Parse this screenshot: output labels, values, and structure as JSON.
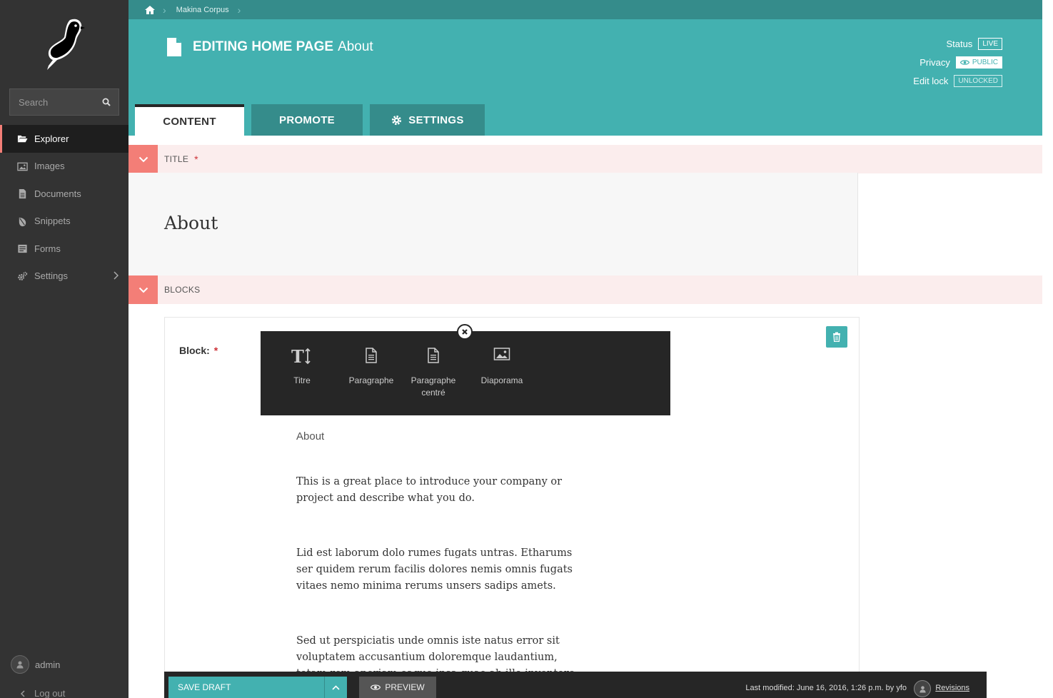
{
  "sidebar": {
    "search_placeholder": "Search",
    "items": [
      {
        "label": "Explorer",
        "icon": "folder-open-icon",
        "active": true
      },
      {
        "label": "Images",
        "icon": "image-icon"
      },
      {
        "label": "Documents",
        "icon": "document-icon"
      },
      {
        "label": "Snippets",
        "icon": "snippet-icon"
      },
      {
        "label": "Forms",
        "icon": "form-icon"
      },
      {
        "label": "Settings",
        "icon": "cogs-icon",
        "has_submenu": true
      }
    ],
    "user": "admin",
    "logout": "Log out"
  },
  "header": {
    "breadcrumb": [
      "Makina Corpus"
    ],
    "title_strong": "EDITING HOME PAGE",
    "title_light": "About",
    "status_label": "Status",
    "status_value": "LIVE",
    "privacy_label": "Privacy",
    "privacy_value": "PUBLIC",
    "editlock_label": "Edit lock",
    "editlock_value": "UNLOCKED",
    "tabs": [
      {
        "label": "CONTENT",
        "active": true
      },
      {
        "label": "PROMOTE"
      },
      {
        "label": "SETTINGS"
      }
    ]
  },
  "form": {
    "title_section": "TITLE",
    "title_value": "About",
    "blocks_section": "BLOCKS",
    "block_label": "Block:",
    "required_mark": "*",
    "chooser": [
      {
        "label": "Titre",
        "icon": "title-icon"
      },
      {
        "label": "Paragraphe",
        "icon": "paragraph-icon"
      },
      {
        "label": "Paragraphe centré",
        "icon": "paragraph-icon"
      },
      {
        "label": "Diaporama",
        "icon": "image-icon"
      }
    ],
    "content_title": "About",
    "paragraphs": [
      "This is a great place to introduce your company or project and describe what you do.",
      "Lid est laborum dolo rumes fugats untras. Etharums ser quidem rerum facilis dolores nemis omnis fugats vitaes nemo minima rerums unsers sadips amets.",
      "Sed ut perspiciatis unde omnis iste natus error sit voluptatem accusantium doloremque laudantium, totam rem aperiam eaque ipsa quae ab illo inventore"
    ]
  },
  "footer": {
    "save_draft": "SAVE DRAFT",
    "preview": "PREVIEW",
    "last_modified": "Last modified: June 16, 2016, 1:26 p.m. by yfo",
    "revisions": "Revisions"
  },
  "colors": {
    "teal": "#43b1b0",
    "teal_dark": "#358c8b",
    "salmon": "#f37e77",
    "sidebar": "#333333"
  }
}
